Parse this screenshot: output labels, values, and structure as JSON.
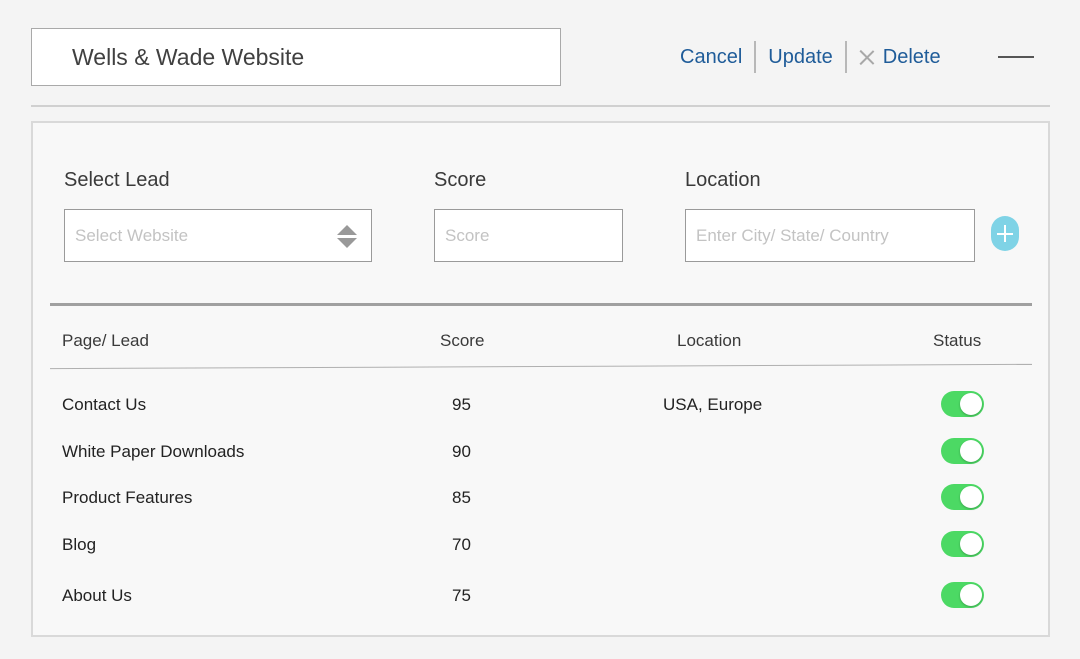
{
  "header": {
    "title": "Wells & Wade Website",
    "actions": {
      "cancel": "Cancel",
      "update": "Update",
      "delete": "Delete"
    }
  },
  "form": {
    "lead_label": "Select Lead",
    "lead_placeholder": "Select Website",
    "score_label": "Score",
    "score_placeholder": "Score",
    "location_label": "Location",
    "location_placeholder": "Enter City/ State/ Country"
  },
  "table": {
    "columns": [
      "Page/ Lead",
      "Score",
      "Location",
      "Status"
    ],
    "rows": [
      {
        "page": "Contact Us",
        "score": "95",
        "location": "USA, Europe",
        "status": true
      },
      {
        "page": "White Paper Downloads",
        "score": "90",
        "location": "",
        "status": true
      },
      {
        "page": "Product Features",
        "score": "85",
        "location": "",
        "status": true
      },
      {
        "page": "Blog",
        "score": "70",
        "location": "",
        "status": true
      },
      {
        "page": "About Us",
        "score": "75",
        "location": "",
        "status": true
      }
    ]
  },
  "colors": {
    "link": "#1f5c99",
    "toggle_on": "#4cd964",
    "add_button": "#7fd3e6"
  },
  "icons": {
    "delete": "close-icon",
    "select": "sort-arrows-icon",
    "add": "plus-icon",
    "minimize": "minimize-icon"
  }
}
